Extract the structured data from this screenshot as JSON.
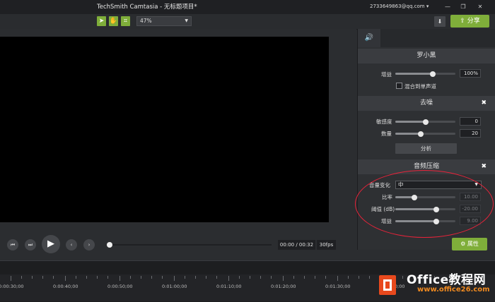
{
  "titlebar": {
    "title": "TechSmith Camtasia - 无标题项目*",
    "account": "2733649863@qq.com ▾",
    "minimize_icon": "minimize-icon",
    "maximize_icon": "maximize-icon",
    "close_icon": "close-icon"
  },
  "toolbar": {
    "zoom_value": "47%",
    "share_label": "分享"
  },
  "panel": {
    "voice": {
      "title": "罗小黑",
      "gain_label": "增益",
      "gain_value": "100%",
      "gain_level": 0.62,
      "mono_label": "混合到单声道"
    },
    "denoise": {
      "title": "去噪",
      "sensitivity_label": "敏感度",
      "sensitivity_value": "0",
      "sensitivity_level": 0.5,
      "amount_label": "数量",
      "amount_value": "20",
      "amount_level": 0.42,
      "analyze_label": "分析"
    },
    "compression": {
      "title": "音频压缩",
      "volume_label": "音量变化",
      "volume_value": "中",
      "ratio_label": "比率",
      "ratio_value": "10.00",
      "ratio_level": 0.32,
      "threshold_label": "阈值 (dB)",
      "threshold_value": "-20.00",
      "threshold_level": 0.68,
      "gain_label": "增益",
      "gain_value": "9.00",
      "gain_level": 0.68
    }
  },
  "playback": {
    "time": "00:00 / 00:32",
    "fps": "30fps",
    "properties_label": "属性"
  },
  "timeline": {
    "labels": [
      "0:00:30;00",
      "0:00:40;00",
      "0:00:50;00",
      "0:01:00;00",
      "0:01:10;00",
      "0:01:20;00",
      "0:01:30;00",
      "0:01:40;00"
    ]
  },
  "watermark": {
    "title": "Office教程网",
    "url": "www.office26.com"
  },
  "colors": {
    "accent": "#7fae3a",
    "annotation": "#e8233a"
  }
}
